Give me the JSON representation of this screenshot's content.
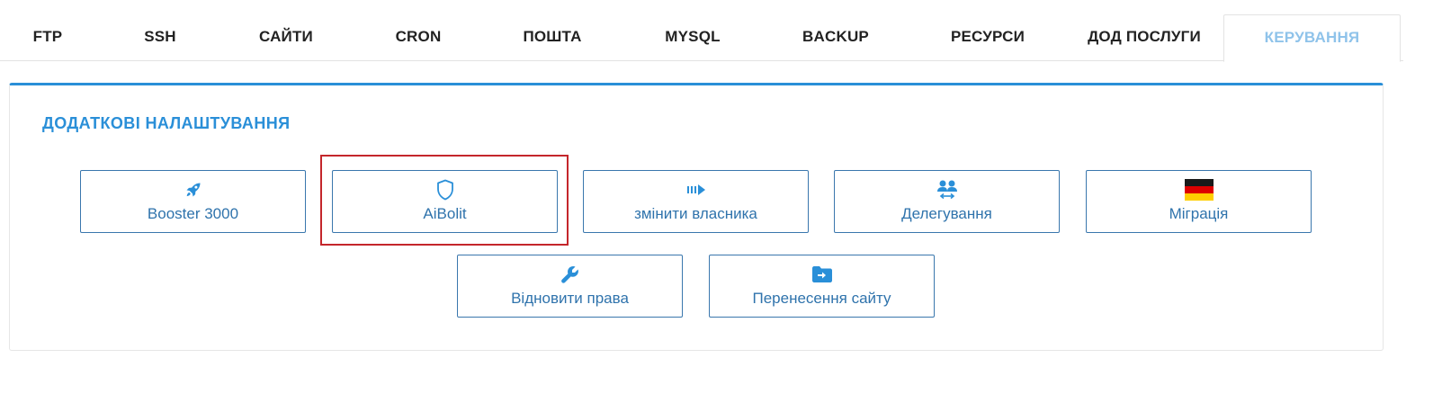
{
  "tabs": [
    {
      "label": "FTP"
    },
    {
      "label": "SSH"
    },
    {
      "label": "САЙТИ"
    },
    {
      "label": "CRON"
    },
    {
      "label": "ПОШТА"
    },
    {
      "label": "MYSQL"
    },
    {
      "label": "BACKUP"
    },
    {
      "label": "РЕСУРСИ"
    },
    {
      "label": "ДОД ПОСЛУГИ"
    },
    {
      "label": "КЕРУВАННЯ"
    }
  ],
  "active_tab": "КЕРУВАННЯ",
  "panel": {
    "title": "ДОДАТКОВІ НАЛАШТУВАННЯ",
    "options": [
      {
        "label": "Booster 3000",
        "icon": "rocket-icon"
      },
      {
        "label": "AiBolit",
        "icon": "shield-icon",
        "highlighted": true
      },
      {
        "label": "змінити власника",
        "icon": "arrow-transfer-icon"
      },
      {
        "label": "Делегування",
        "icon": "users-swap-icon"
      },
      {
        "label": "Міграція",
        "icon": "german-flag-icon"
      },
      {
        "label": "Відновити права",
        "icon": "wrench-icon"
      },
      {
        "label": "Перенесення сайту",
        "icon": "folder-arrow-icon"
      }
    ]
  },
  "colors": {
    "accent": "#2a8fd8",
    "button_text": "#2f73ac",
    "button_border": "#3a77ad",
    "active_tab_text": "#8fc3ea",
    "highlight": "#c4262b"
  }
}
